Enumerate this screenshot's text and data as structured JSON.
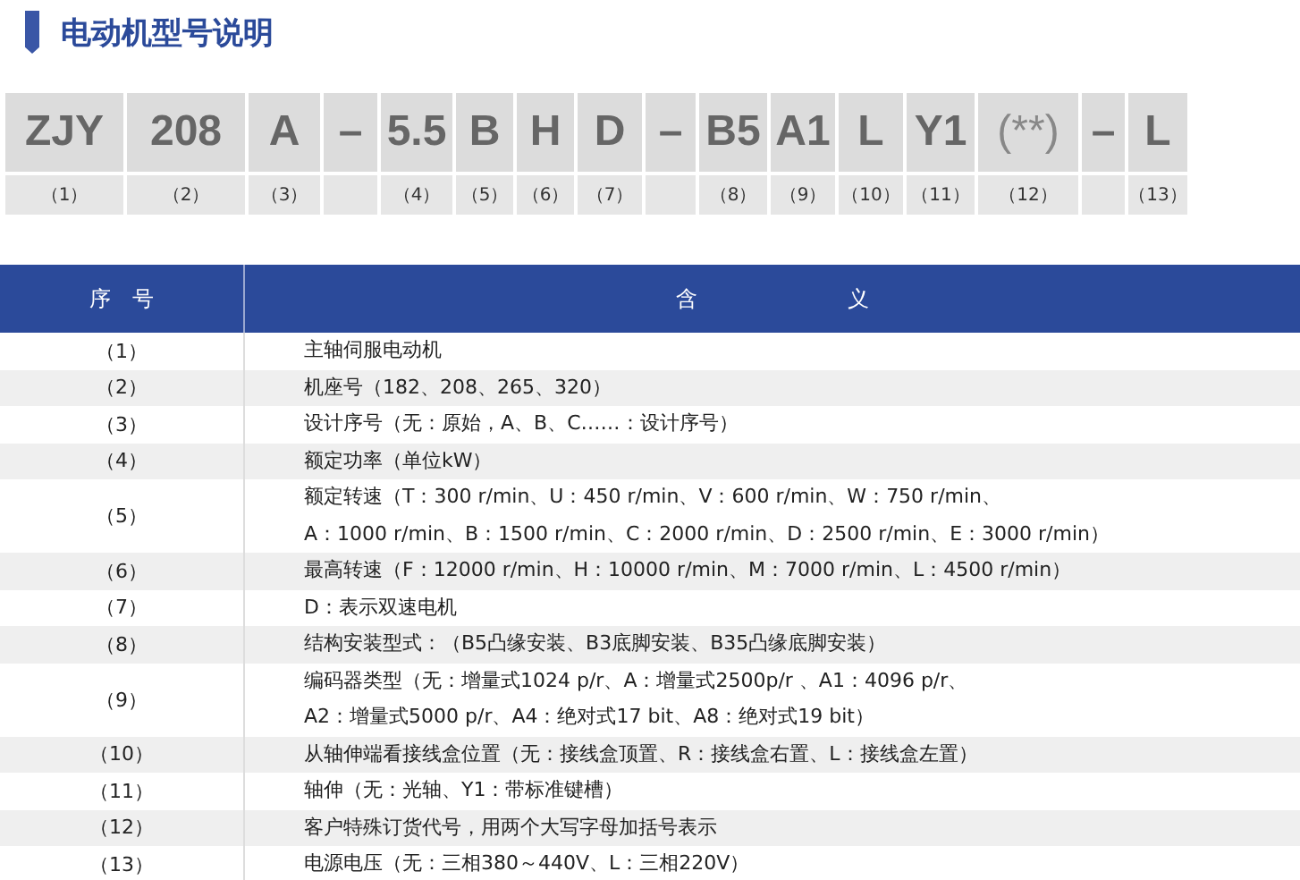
{
  "title": "电动机型号说明",
  "codes": [
    {
      "code": "ZJY",
      "label": "（1）"
    },
    {
      "code": "208",
      "label": "（2）"
    },
    {
      "code": "A",
      "label": "（3）"
    },
    {
      "code": "–"
    },
    {
      "code": "5.5",
      "label": "（4）"
    },
    {
      "code": "B",
      "label": "（5）"
    },
    {
      "code": "H",
      "label": "（6）"
    },
    {
      "code": "D",
      "label": "（7）"
    },
    {
      "code": "–"
    },
    {
      "code": "B5",
      "label": "（8）"
    },
    {
      "code": "A1",
      "label": "（9）"
    },
    {
      "code": "L",
      "label": "（10）"
    },
    {
      "code": "Y1",
      "label": "（11）"
    },
    {
      "code": "(**)",
      "label": "（12）"
    },
    {
      "code": "–"
    },
    {
      "code": "L",
      "label": "（13）"
    }
  ],
  "table": {
    "columns": [
      "序　号",
      "含　　　　　　　义"
    ],
    "rows": [
      {
        "index": "（1）",
        "lines": [
          "主轴伺服电动机"
        ]
      },
      {
        "index": "（2）",
        "lines": [
          "机座号（182、208、265、320）"
        ]
      },
      {
        "index": "（3）",
        "lines": [
          "设计序号（无：原始，A、B、C……：设计序号）"
        ]
      },
      {
        "index": "（4）",
        "lines": [
          "额定功率（单位kW）"
        ]
      },
      {
        "index": "（5）",
        "lines": [
          "额定转速（T：300 r/min、U：450 r/min、V：600 r/min、W：750 r/min、",
          "A：1000 r/min、B：1500 r/min、C：2000 r/min、D：2500 r/min、E：3000 r/min）"
        ]
      },
      {
        "index": "（6）",
        "lines": [
          "最高转速（F：12000 r/min、H：10000 r/min、M：7000 r/min、L：4500 r/min）"
        ]
      },
      {
        "index": "（7）",
        "lines": [
          "D：表示双速电机"
        ]
      },
      {
        "index": "（8）",
        "lines": [
          "结构安装型式：（B5凸缘安装、B3底脚安装、B35凸缘底脚安装）"
        ]
      },
      {
        "index": "（9）",
        "lines": [
          "编码器类型（无：增量式1024 p/r、A：增量式2500p/r 、A1：4096 p/r、",
          "A2：增量式5000 p/r、A4：绝对式17 bit、A8：绝对式19 bit）"
        ]
      },
      {
        "index": "（10）",
        "lines": [
          "从轴伸端看接线盒位置（无：接线盒顶置、R：接线盒右置、L：接线盒左置）"
        ]
      },
      {
        "index": "（11）",
        "lines": [
          "轴伸（无：光轴、Y1：带标准键槽）"
        ]
      },
      {
        "index": "（12）",
        "lines": [
          "客户特殊订货代号，用两个大写字母加括号表示"
        ]
      },
      {
        "index": "（13）",
        "lines": [
          "电源电压（无：三相380～440V、L：三相220V）"
        ]
      }
    ]
  }
}
